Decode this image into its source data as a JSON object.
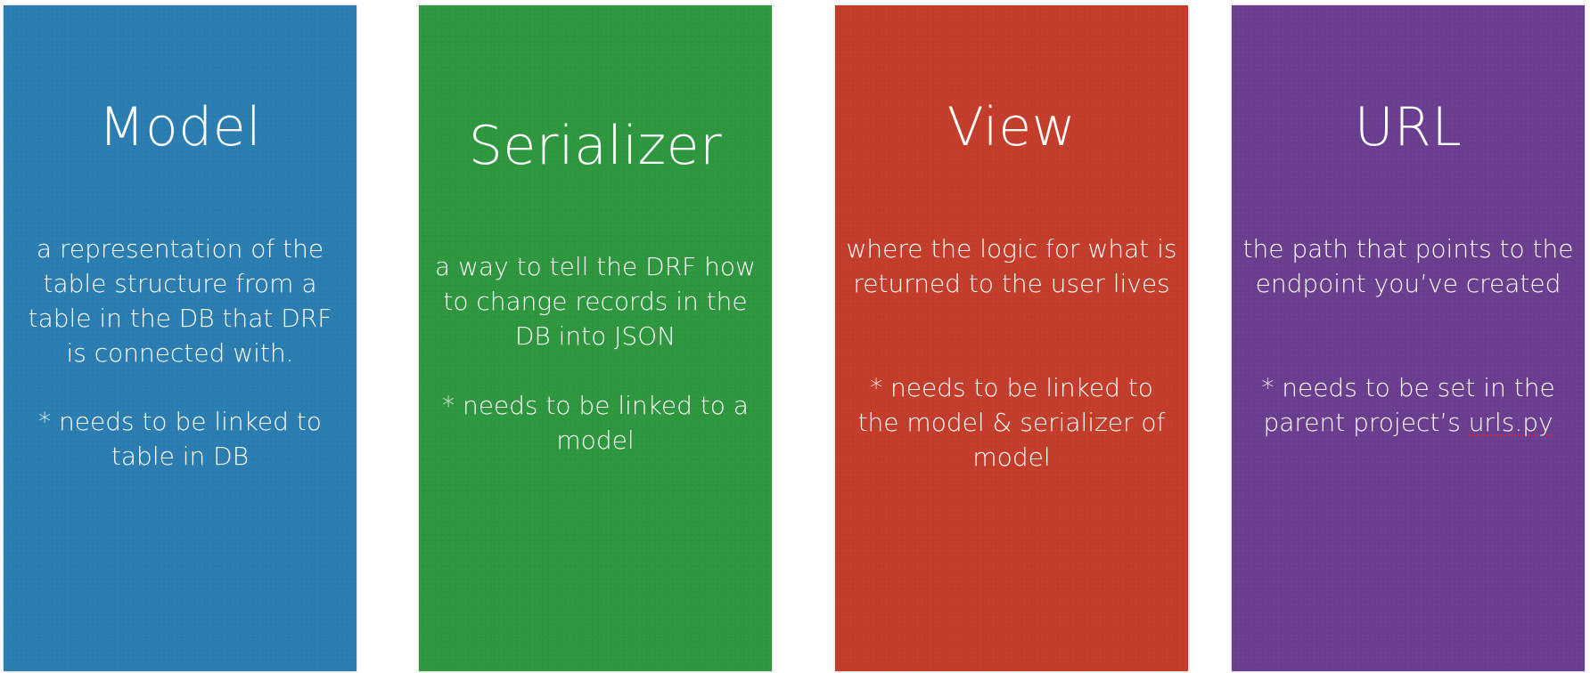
{
  "cards": [
    {
      "title": "Model",
      "description": "a representation of the table structure from a table in the DB that DRF is connected with.",
      "note": "* needs to be linked to table in DB",
      "color": "#2b7db1"
    },
    {
      "title": "Serializer",
      "description": "a way to tell the DRF how to change records in the DB into JSON",
      "note": "* needs to be linked to a model",
      "color": "#2e963e"
    },
    {
      "title": "View",
      "description": "where the logic for what is returned to the user lives",
      "note": "* needs to be linked to the model & serializer of model",
      "color": "#c33d2a"
    },
    {
      "title": "URL",
      "description": "the path that points to the endpoint you’ve created",
      "note_prefix": "* needs to be set in the parent project’s ",
      "note_file": "urls.py",
      "color": "#6a3e8f"
    }
  ]
}
